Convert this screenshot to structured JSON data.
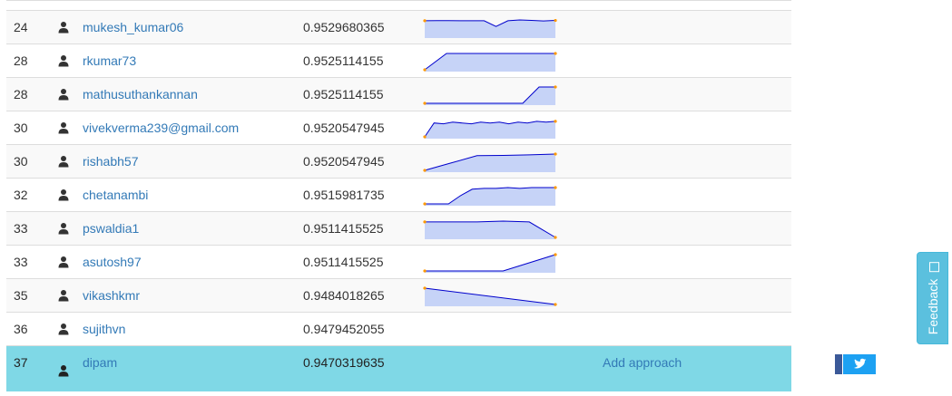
{
  "leaderboard": {
    "rows": [
      {
        "rank": "24",
        "username": "mukesh_kumar06",
        "score": "0.9529680365",
        "trend": [
          0.95,
          0.96,
          0.96,
          0.95,
          0.95,
          0.95,
          0.6,
          0.95,
          1.0,
          0.97,
          0.94,
          0.97
        ]
      },
      {
        "rank": "28",
        "username": "rkumar73",
        "score": "0.9525114155",
        "trend": [
          0.0,
          1.0,
          1.0,
          1.0,
          1.0,
          1.0,
          1.0
        ]
      },
      {
        "rank": "28",
        "username": "mathusuthankannan",
        "score": "0.9525114155",
        "trend": [
          0.0,
          0.0,
          0.0,
          0.0,
          0.0,
          0.0,
          0.0,
          1.0,
          1.0
        ]
      },
      {
        "rank": "30",
        "username": "vivekverma239@gmail.com",
        "score": "0.9520547945",
        "trend": [
          0.0,
          0.85,
          0.8,
          0.9,
          0.85,
          0.8,
          0.9,
          0.85,
          0.9,
          0.8,
          0.9,
          0.85,
          0.95,
          0.9,
          0.95
        ]
      },
      {
        "rank": "30",
        "username": "rishabh57",
        "score": "0.9520547945",
        "trend": [
          0.0,
          0.45,
          0.9,
          0.92,
          0.95,
          1.0
        ]
      },
      {
        "rank": "32",
        "username": "chetanambi",
        "score": "0.9515981735",
        "trend": [
          0.0,
          0.0,
          0.0,
          0.5,
          0.9,
          0.95,
          0.95,
          1.0,
          0.95,
          1.0,
          1.0,
          1.0
        ]
      },
      {
        "rank": "33",
        "username": "pswaldia1",
        "score": "0.9511415525",
        "trend": [
          0.95,
          0.95,
          0.95,
          1.0,
          0.95,
          0.0
        ]
      },
      {
        "rank": "33",
        "username": "asutosh97",
        "score": "0.9511415525",
        "trend": [
          0.0,
          0.0,
          0.0,
          0.0,
          0.5,
          1.0
        ]
      },
      {
        "rank": "35",
        "username": "vikashkmr",
        "score": "0.9484018265",
        "trend": [
          1.0,
          0.0
        ]
      },
      {
        "rank": "36",
        "username": "sujithvn",
        "score": "0.9479452055",
        "trend": []
      }
    ],
    "current_user": {
      "rank": "37",
      "username": "dipam",
      "score": "0.9470319635",
      "action_label": "Add approach"
    }
  },
  "feedback": {
    "label": "Feedback",
    "icon": "feedback-icon"
  },
  "social": {
    "facebook_icon": "facebook-icon",
    "twitter_icon": "twitter-icon"
  },
  "colors": {
    "link": "#337ab7",
    "highlight_row": "#7fd8e6",
    "spark_line": "#0000cc",
    "spark_fill": "#c6d3f7",
    "spark_marker": "#ff9900",
    "feedback_bg": "#5bc0de"
  }
}
